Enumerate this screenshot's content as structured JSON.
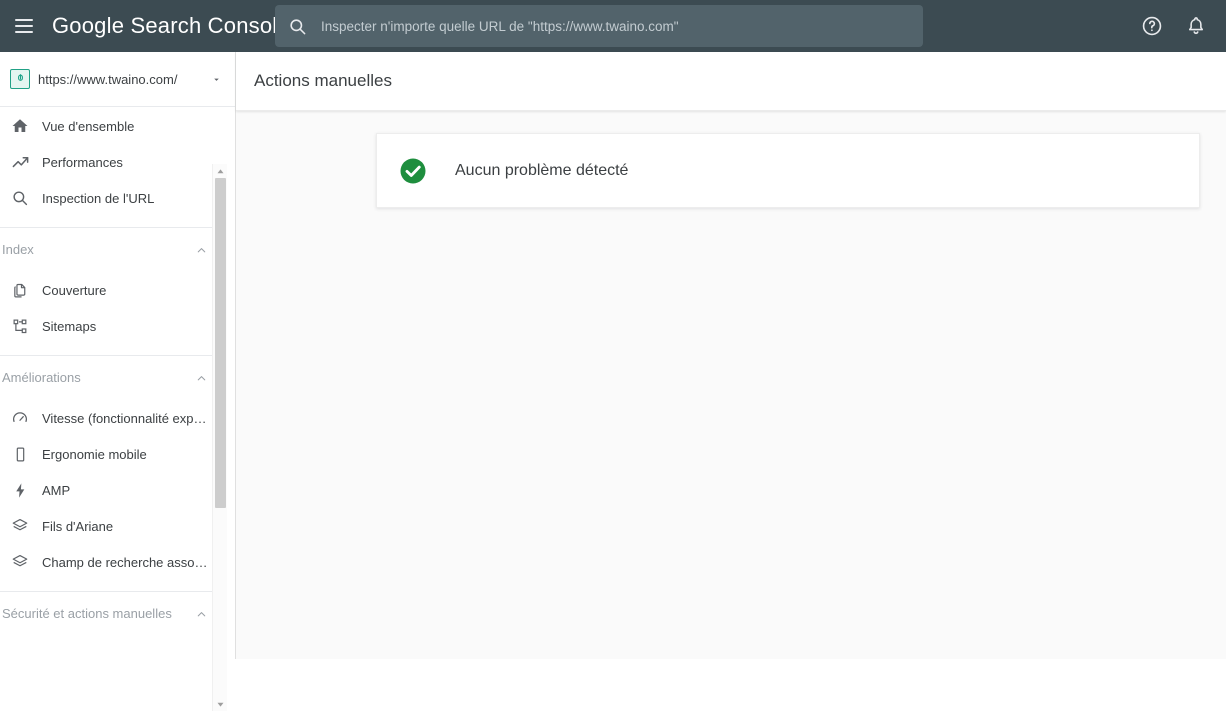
{
  "topbar": {
    "menu_icon": "hamburger-menu-icon",
    "brand_bold": "Google",
    "brand_rest": "Search Console",
    "search": {
      "icon": "search-icon",
      "value": "",
      "placeholder": "Inspecter n'importe quelle URL de \"https://www.twaino.com\""
    },
    "help_icon": "help-circle-icon",
    "notifications_icon": "bell-icon",
    "background": "#3c4b52",
    "search_background": "#52636b"
  },
  "sidebar": {
    "property": {
      "icon": "site-property-icon",
      "url": "https://www.twaino.com/",
      "caret_icon": "chevron-down-icon"
    },
    "items": [
      {
        "label": "Vue d'ensemble",
        "icon": "home-icon"
      },
      {
        "label": "Performances",
        "icon": "trending-up-icon"
      },
      {
        "label": "Inspection de l'URL",
        "icon": "search-icon"
      }
    ],
    "groups": [
      {
        "label": "Index",
        "chevron_icon": "chevron-up-icon",
        "items": [
          {
            "label": "Couverture",
            "icon": "document-copy-icon"
          },
          {
            "label": "Sitemaps",
            "icon": "sitemap-icon"
          }
        ]
      },
      {
        "label": "Améliorations",
        "chevron_icon": "chevron-up-icon",
        "items": [
          {
            "label": "Vitesse (fonctionnalité expé…",
            "icon": "speed-gauge-icon"
          },
          {
            "label": "Ergonomie mobile",
            "icon": "mobile-device-icon"
          },
          {
            "label": "AMP",
            "icon": "lightning-bolt-icon"
          },
          {
            "label": "Fils d'Ariane",
            "icon": "layers-icon"
          },
          {
            "label": "Champ de recherche associ…",
            "icon": "layers-icon"
          }
        ]
      },
      {
        "label": "Sécurité et actions manuelles",
        "chevron_icon": "chevron-up-icon",
        "items": []
      }
    ],
    "scrollbar": {
      "up_icon": "scroll-up-arrow-icon",
      "down_icon": "scroll-down-arrow-icon"
    }
  },
  "main": {
    "page_title": "Actions manuelles",
    "card": {
      "status_icon": "check-circle-icon",
      "status_color": "#1e8e3e",
      "status_text": "Aucun problème détecté"
    }
  }
}
